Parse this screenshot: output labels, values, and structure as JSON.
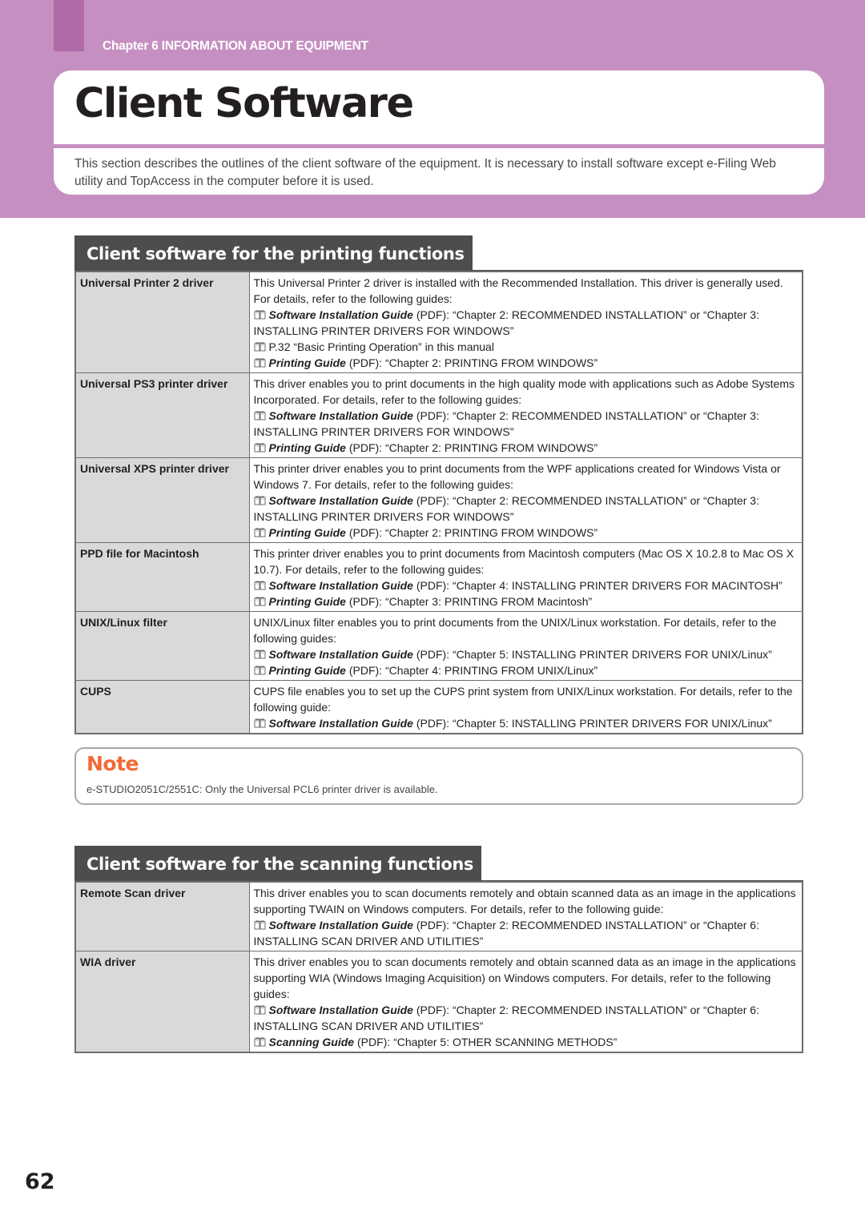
{
  "header": {
    "chapter": "Chapter 6 INFORMATION ABOUT EQUIPMENT",
    "title": "Client Software",
    "intro": "This section describes the outlines of the client software of the equipment. It is necessary to install software except e-Filing Web utility and TopAccess in the computer before it is used."
  },
  "colors": {
    "band": "#c68fc1",
    "tab_block": "#b16aa8",
    "section_header": "#4d4d4f",
    "name_cell": "#d9d9da",
    "note_title": "#f26a36"
  },
  "icons": {
    "reference": "book-icon"
  },
  "printing": {
    "heading": "Client software for the printing functions",
    "rows": [
      {
        "name": "Universal Printer 2 driver",
        "text": "This Universal Printer 2 driver is installed with the Recommended Installation. This driver is generally used. For details, refer to the following guides:",
        "refs": [
          {
            "guide": "Software Installation Guide",
            "rest": " (PDF): “Chapter 2: RECOMMENDED INSTALLATION” or “Chapter 3: INSTALLING PRINTER DRIVERS FOR WINDOWS”"
          },
          {
            "guide": "",
            "rest": "P.32 “Basic Printing Operation” in this manual"
          },
          {
            "guide": "Printing Guide",
            "rest": " (PDF): “Chapter 2: PRINTING FROM WINDOWS”"
          }
        ]
      },
      {
        "name": "Universal PS3 printer driver",
        "text": "This driver enables you to print documents in the high quality mode with applications such as Adobe Systems Incorporated. For details, refer to the following guides:",
        "refs": [
          {
            "guide": "Software Installation Guide",
            "rest": " (PDF): “Chapter 2: RECOMMENDED INSTALLATION” or “Chapter 3: INSTALLING PRINTER DRIVERS FOR WINDOWS”"
          },
          {
            "guide": "Printing Guide",
            "rest": " (PDF): “Chapter 2: PRINTING FROM WINDOWS”"
          }
        ]
      },
      {
        "name": "Universal XPS printer driver",
        "text": "This printer driver enables you to print documents from the WPF applications created for Windows Vista or Windows 7. For details, refer to the following guides:",
        "refs": [
          {
            "guide": "Software Installation Guide",
            "rest": " (PDF): “Chapter 2: RECOMMENDED INSTALLATION” or “Chapter 3: INSTALLING PRINTER DRIVERS FOR WINDOWS”"
          },
          {
            "guide": "Printing Guide",
            "rest": " (PDF): “Chapter 2: PRINTING FROM WINDOWS”"
          }
        ]
      },
      {
        "name": "PPD file for Macintosh",
        "text": "This printer driver enables you to print documents from Macintosh computers (Mac OS X 10.2.8 to Mac OS X 10.7). For details, refer to the following guides:",
        "refs": [
          {
            "guide": "Software Installation Guide",
            "rest": " (PDF): “Chapter 4: INSTALLING PRINTER DRIVERS FOR MACINTOSH”"
          },
          {
            "guide": "Printing Guide",
            "rest": " (PDF): “Chapter 3: PRINTING FROM Macintosh”"
          }
        ]
      },
      {
        "name": "UNIX/Linux filter",
        "text": "UNIX/Linux filter enables you to print documents from the UNIX/Linux workstation. For details, refer to the following guides:",
        "refs": [
          {
            "guide": "Software Installation Guide",
            "rest": " (PDF): “Chapter 5: INSTALLING PRINTER DRIVERS FOR UNIX/Linux”"
          },
          {
            "guide": "Printing Guide",
            "rest": " (PDF): “Chapter 4: PRINTING FROM UNIX/Linux”"
          }
        ]
      },
      {
        "name": "CUPS",
        "text": "CUPS file enables you to set up the CUPS print system from UNIX/Linux workstation. For details, refer to the following guide:",
        "refs": [
          {
            "guide": "Software Installation Guide",
            "rest": " (PDF): “Chapter 5: INSTALLING PRINTER DRIVERS FOR UNIX/Linux”"
          }
        ]
      }
    ]
  },
  "note": {
    "title": "Note",
    "text": "e-STUDIO2051C/2551C: Only the Universal PCL6 printer driver is available."
  },
  "scanning": {
    "heading": "Client software for the scanning functions",
    "rows": [
      {
        "name": "Remote Scan driver",
        "text": "This driver enables you to scan documents remotely and obtain scanned data as an image in the applications supporting TWAIN on Windows computers. For details, refer to the following guide:",
        "refs": [
          {
            "guide": "Software Installation Guide",
            "rest": " (PDF): “Chapter 2: RECOMMENDED INSTALLATION” or “Chapter 6: INSTALLING SCAN DRIVER AND UTILITIES”"
          }
        ]
      },
      {
        "name": "WIA driver",
        "text": "This driver enables you to scan documents remotely and obtain scanned data as an image in the applications supporting WIA (Windows Imaging Acquisition) on Windows computers. For details, refer to the following guides:",
        "refs": [
          {
            "guide": "Software Installation Guide",
            "rest": " (PDF): “Chapter 2: RECOMMENDED INSTALLATION” or “Chapter 6: INSTALLING SCAN DRIVER AND UTILITIES”"
          },
          {
            "guide": "Scanning Guide",
            "rest": " (PDF): “Chapter 5: OTHER SCANNING METHODS”"
          }
        ]
      }
    ]
  },
  "footer": {
    "page_number": "62"
  }
}
